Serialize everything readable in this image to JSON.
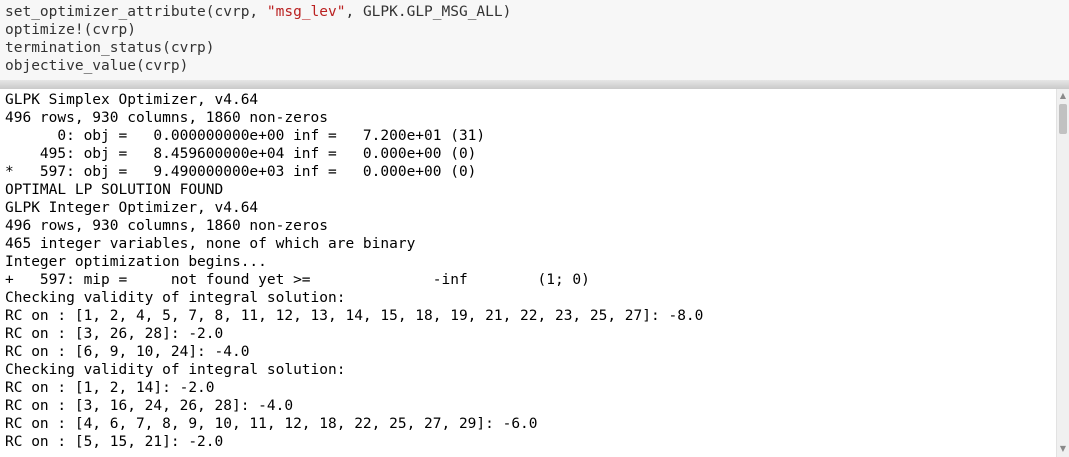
{
  "code_cell": {
    "lines": [
      [
        {
          "t": "set_optimizer_attribute(cvrp, ",
          "c": "default"
        },
        {
          "t": "\"msg_lev\"",
          "c": "string"
        },
        {
          "t": ", GLPK.GLP_MSG_ALL)",
          "c": "default"
        }
      ],
      [
        {
          "t": "optimize!(cvrp)",
          "c": "default"
        }
      ],
      [
        {
          "t": "termination_status(cvrp)",
          "c": "default"
        }
      ],
      [
        {
          "t": "objective_value(cvrp)",
          "c": "default"
        }
      ]
    ]
  },
  "output": {
    "lines": [
      "GLPK Simplex Optimizer, v4.64",
      "496 rows, 930 columns, 1860 non-zeros",
      "      0: obj =   0.000000000e+00 inf =   7.200e+01 (31)",
      "    495: obj =   8.459600000e+04 inf =   0.000e+00 (0)",
      "*   597: obj =   9.490000000e+03 inf =   0.000e+00 (0)",
      "OPTIMAL LP SOLUTION FOUND",
      "GLPK Integer Optimizer, v4.64",
      "496 rows, 930 columns, 1860 non-zeros",
      "465 integer variables, none of which are binary",
      "Integer optimization begins...",
      "+   597: mip =     not found yet >=              -inf        (1; 0)",
      "Checking validity of integral solution:",
      "RC on : [1, 2, 4, 5, 7, 8, 11, 12, 13, 14, 15, 18, 19, 21, 22, 23, 25, 27]: -8.0",
      "RC on : [3, 26, 28]: -2.0",
      "RC on : [6, 9, 10, 24]: -4.0",
      "Checking validity of integral solution:",
      "RC on : [1, 2, 14]: -2.0",
      "RC on : [3, 16, 24, 26, 28]: -4.0",
      "RC on : [4, 6, 7, 8, 9, 10, 11, 12, 18, 22, 25, 27, 29]: -6.0",
      "RC on : [5, 15, 21]: -2.0"
    ]
  },
  "scrollbar": {
    "up_icon": "arrow-up-icon",
    "down_icon": "arrow-down-icon",
    "up_glyph": "▲",
    "down_glyph": "▼"
  },
  "colors": {
    "code_background": "#f7f7f7",
    "code_text": "#333333",
    "string_literal": "#ba2121",
    "output_text": "#000000"
  }
}
